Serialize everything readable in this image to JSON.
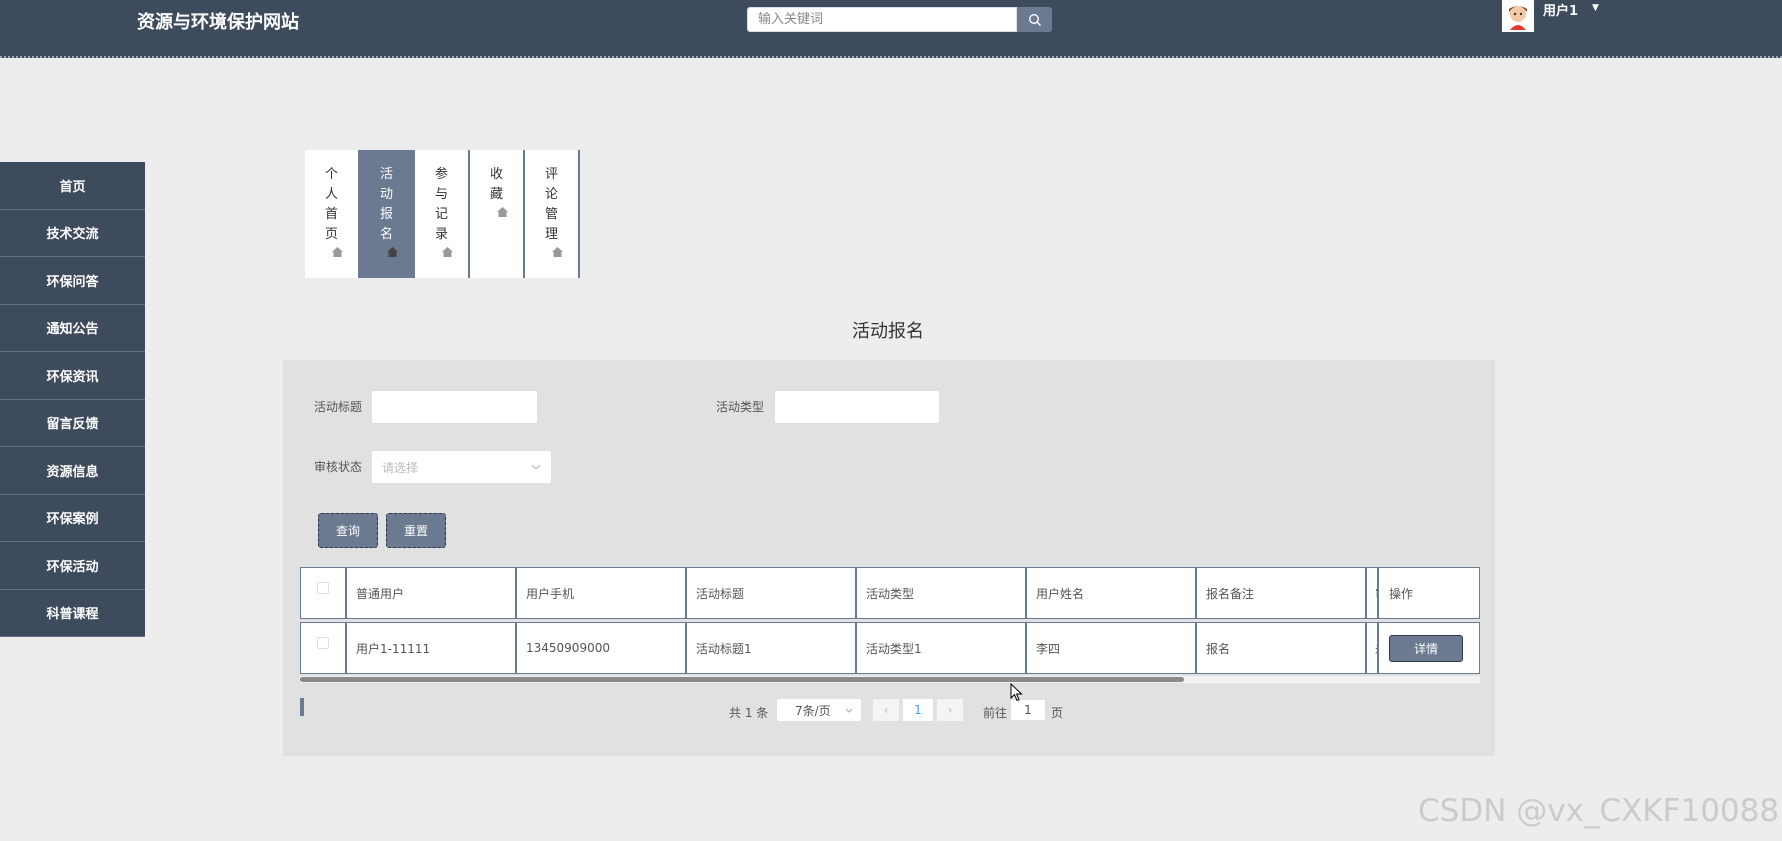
{
  "header": {
    "site_title": "资源与环境保护网站",
    "search_placeholder": "输入关键词",
    "username": "用户1"
  },
  "sidebar": {
    "items": [
      {
        "label": "首页"
      },
      {
        "label": "技术交流"
      },
      {
        "label": "环保问答"
      },
      {
        "label": "通知公告"
      },
      {
        "label": "环保资讯"
      },
      {
        "label": "留言反馈"
      },
      {
        "label": "资源信息"
      },
      {
        "label": "环保案例"
      },
      {
        "label": "环保活动"
      },
      {
        "label": "科普课程"
      }
    ]
  },
  "tabs": [
    {
      "label": "个人首页",
      "active": false
    },
    {
      "label": "活动报名",
      "active": true
    },
    {
      "label": "参与记录",
      "active": false
    },
    {
      "label": "收藏",
      "active": false
    },
    {
      "label": "评论管理",
      "active": false
    }
  ],
  "section_title": "活动报名",
  "filters": {
    "activity_title_label": "活动标题",
    "activity_title_value": "",
    "activity_type_label": "活动类型",
    "activity_type_value": "",
    "review_status_label": "审核状态",
    "review_status_placeholder": "请选择",
    "query_button": "查询",
    "reset_button": "重置"
  },
  "table": {
    "headers": [
      "普通用户",
      "用户手机",
      "活动标题",
      "活动类型",
      "用户姓名",
      "报名备注",
      "审",
      "操作"
    ],
    "rows": [
      {
        "cells": [
          "用户1-11111",
          "13450909000",
          "活动标题1",
          "活动类型1",
          "李四",
          "报名",
          "未"
        ],
        "action": "详情"
      }
    ],
    "scroll_fraction": 0.75
  },
  "pagination": {
    "total": "共 1 条",
    "page_size": "7条/页",
    "current_page": "1",
    "goto_label": "前往",
    "goto_value": "1",
    "page_label": "页"
  },
  "watermark": "CSDN @vx_CXKF10088"
}
